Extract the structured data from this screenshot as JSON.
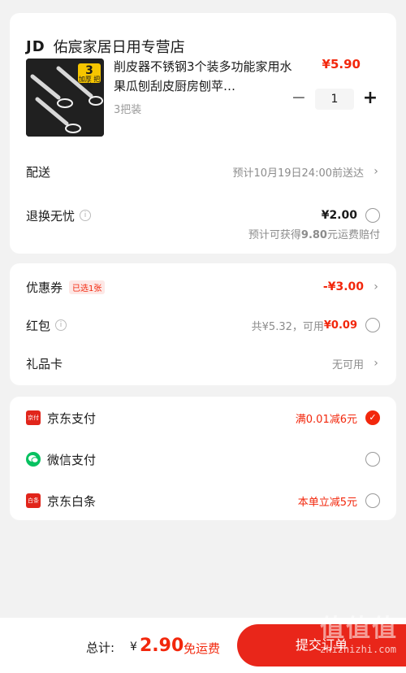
{
  "store": {
    "logo_text": "JD",
    "name": "佑宸家居日用专营店"
  },
  "product": {
    "title": "削皮器不锈钢3个装多功能家用水果瓜刨刮皮厨房刨苹…",
    "spec": "3把装",
    "price": "¥5.90",
    "quantity": "1",
    "badge_big": "3",
    "badge_small": "加厚 把装"
  },
  "delivery": {
    "label": "配送",
    "value": "预计10月19日24:00前送达"
  },
  "return_insurance": {
    "label": "退换无忧",
    "price": "¥2.00",
    "note_prefix": "预计可获得",
    "note_amount": "9.80",
    "note_suffix": "元运费赔付"
  },
  "coupon": {
    "label": "优惠券",
    "tag": "已选1张",
    "value": "-¥3.00"
  },
  "red_packet": {
    "label": "红包",
    "total_text": "共¥5.32，可用",
    "usable": "¥0.09"
  },
  "gift_card": {
    "label": "礼品卡",
    "value": "无可用"
  },
  "payment": {
    "jd_pay": {
      "label": "京东支付",
      "promo": "满0.01减6元",
      "icon_text": "京付",
      "selected": true
    },
    "wechat": {
      "label": "微信支付",
      "selected": false
    },
    "baitiao": {
      "label": "京东白条",
      "promo": "本单立减5元",
      "icon_text": "白条",
      "selected": false
    }
  },
  "footer": {
    "total_label": "总计:",
    "currency": "¥",
    "total": "2.90",
    "shipping": "免运费",
    "submit": "提交订单"
  },
  "watermark": {
    "big": "值值值",
    "site": "zhizhizhi.com"
  },
  "colors": {
    "accent": "#f2270c",
    "background": "#f2f2f2"
  }
}
